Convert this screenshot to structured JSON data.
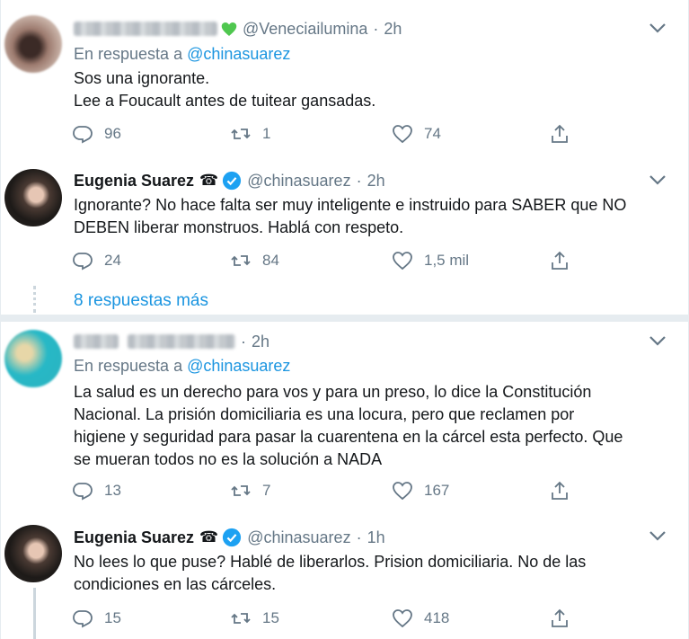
{
  "tweets": [
    {
      "handle": "@Veneciailumina",
      "time": "2h",
      "reply_prefix": "En respuesta a",
      "reply_to": "@chinasuarez",
      "lines": [
        "Sos una ignorante.",
        "Lee a Foucault antes de tuitear gansadas."
      ],
      "replies": "96",
      "retweets": "1",
      "likes": "74"
    },
    {
      "name": "Eugenia Suarez",
      "handle": "@chinasuarez",
      "time": "2h",
      "lines": [
        "Ignorante? No hace falta ser muy inteligente e instruido para SABER que NO",
        "DEBEN liberar monstruos. Hablá con respeto."
      ],
      "replies": "24",
      "retweets": "84",
      "likes": "1,5 mil"
    },
    {
      "time": "2h",
      "reply_prefix": "En respuesta a",
      "reply_to": "@chinasuarez",
      "lines": [
        "La salud es un derecho para vos y para un preso, lo dice la Constitución",
        "Nacional. La prisión domiciliaria es una locura, pero que reclamen por",
        "higiene y seguridad para pasar la cuarentena en la cárcel esta perfecto. Que",
        "se mueran todos no es la solución a NADA"
      ],
      "replies": "13",
      "retweets": "7",
      "likes": "167"
    },
    {
      "name": "Eugenia Suarez",
      "handle": "@chinasuarez",
      "time": "1h",
      "lines": [
        "No lees lo que puse? Hablé de liberarlos. Prision domiciliaria. No de las",
        "condiciones en las cárceles."
      ],
      "replies": "15",
      "retweets": "15",
      "likes": "418"
    }
  ],
  "more_replies": "8 respuestas más",
  "icons": [
    "reply-icon",
    "retweet-icon",
    "like-icon",
    "share-icon",
    "chevron-down-icon",
    "verified-badge-icon",
    "green-heart-icon",
    "phone-icon"
  ],
  "colors": {
    "link": "#1b95e0",
    "muted": "#657786",
    "verified": "#1da1f2",
    "heart": "#4fc74f"
  }
}
